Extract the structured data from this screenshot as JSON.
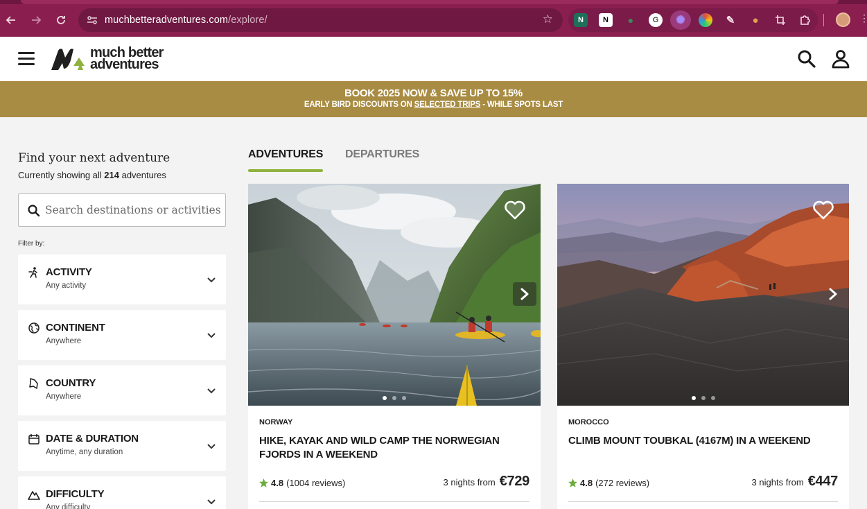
{
  "browser": {
    "url_domain": "muchbetteradventures.com",
    "url_path": "/explore/",
    "extensions": [
      "N",
      "N",
      "",
      "G",
      "",
      "",
      "",
      "",
      "",
      ""
    ]
  },
  "site": {
    "logo_line1": "much better",
    "logo_line2": "adventures"
  },
  "promo": {
    "title": "BOOK 2025 NOW & SAVE UP TO 15%",
    "sub_prefix": "EARLY BIRD DISCOUNTS ON ",
    "sub_link": "SELECTED TRIPS",
    "sub_suffix": " - WHILE SPOTS LAST"
  },
  "sidebar": {
    "title": "Find your next adventure",
    "showing_prefix": "Currently showing all ",
    "showing_count": "214",
    "showing_suffix": " adventures",
    "search_placeholder": "Search destinations or activities",
    "filter_by": "Filter by:",
    "filters": [
      {
        "title": "ACTIVITY",
        "sub": "Any activity"
      },
      {
        "title": "CONTINENT",
        "sub": "Anywhere"
      },
      {
        "title": "COUNTRY",
        "sub": "Anywhere"
      },
      {
        "title": "DATE & DURATION",
        "sub": "Anytime, any duration"
      },
      {
        "title": "DIFFICULTY",
        "sub": "Any difficulty"
      }
    ]
  },
  "tabs": {
    "adventures": "ADVENTURES",
    "departures": "DEPARTURES"
  },
  "cards": [
    {
      "country": "NORWAY",
      "title": "HIKE, KAYAK AND WILD CAMP THE NORWEGIAN FJORDS IN A WEEKEND",
      "rating": "4.8",
      "reviews": "(1004 reviews)",
      "nights": "3 nights from",
      "price": "€729"
    },
    {
      "country": "MOROCCO",
      "title": "CLIMB MOUNT TOUBKAL (4167M) IN A WEEKEND",
      "rating": "4.8",
      "reviews": "(272 reviews)",
      "nights": "3 nights from",
      "price": "€447"
    }
  ],
  "colors": {
    "browser_frame": "#8a1f4f",
    "promo_bg": "#a98c43",
    "accent_green": "#8fb23e"
  }
}
